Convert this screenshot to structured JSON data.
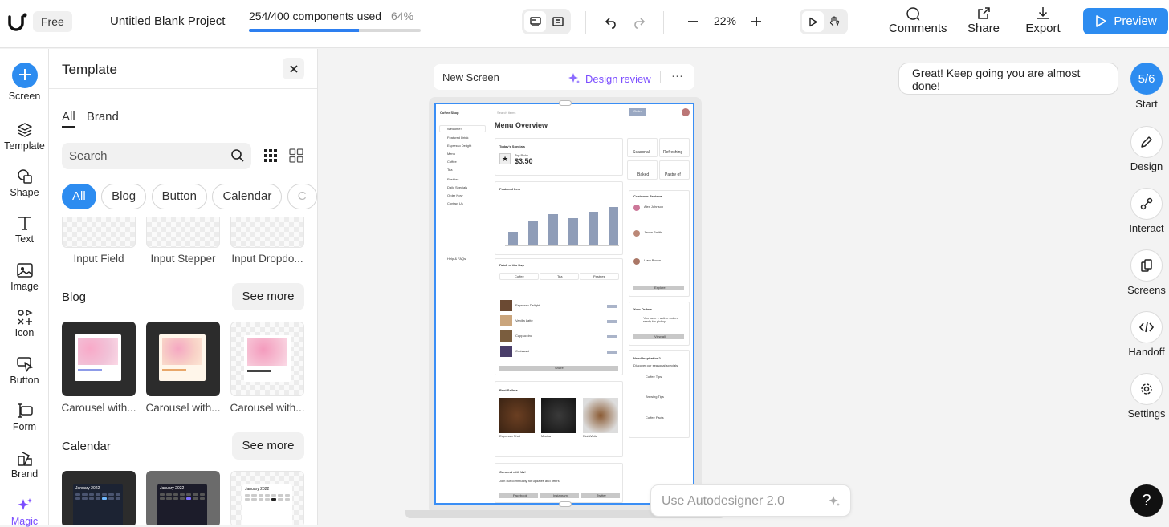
{
  "topbar": {
    "plan_badge": "Free",
    "project_title": "Untitled Blank Project",
    "usage_text": "254/400 components used",
    "usage_percent_text": "64%",
    "usage_fraction": 0.64,
    "zoom_level": "22%",
    "comments_label": "Comments",
    "share_label": "Share",
    "export_label": "Export",
    "preview_label": "Preview",
    "accent_color": "#2d8cf0"
  },
  "left_nav": [
    {
      "label": "Screen",
      "icon": "plus-icon"
    },
    {
      "label": "Template",
      "icon": "layers-icon"
    },
    {
      "label": "Shape",
      "icon": "shape-icon"
    },
    {
      "label": "Text",
      "icon": "text-icon"
    },
    {
      "label": "Image",
      "icon": "image-icon"
    },
    {
      "label": "Icon",
      "icon": "icon-set-icon"
    },
    {
      "label": "Button",
      "icon": "button-icon"
    },
    {
      "label": "Form",
      "icon": "form-icon"
    },
    {
      "label": "Brand",
      "icon": "brand-icon"
    },
    {
      "label": "Magic",
      "icon": "sparkle-icon"
    }
  ],
  "panel": {
    "title": "Template",
    "tabs": [
      "All",
      "Brand"
    ],
    "search_placeholder": "Search",
    "chips": [
      "All",
      "Blog",
      "Button",
      "Calendar",
      "C"
    ],
    "form_items": [
      "Input Field",
      "Input Stepper",
      "Input Dropdo..."
    ],
    "sections": [
      {
        "title": "Blog",
        "see_more": "See more",
        "items": [
          "Carousel with...",
          "Carousel with...",
          "Carousel with..."
        ]
      },
      {
        "title": "Calendar",
        "see_more": "See more",
        "items": [
          "January 2022",
          "January 2022",
          "January 2022"
        ]
      }
    ]
  },
  "canvas": {
    "screen_name": "New Screen",
    "design_review": "Design review",
    "more": "···",
    "mockup": {
      "app": "Coffee Shop",
      "search": "Search items",
      "order_btn": "Order",
      "nav": [
        "Welcome!",
        "Featured Drink",
        "Espresso Delight",
        "Menu",
        "Coffee",
        "Tea",
        "Pastries",
        "Daily Specials",
        "Order Now",
        "Contact Us"
      ],
      "help": "Help & FAQs",
      "heading": "Menu Overview",
      "specials_title": "Today's Specials",
      "top_picks": "Top Picks",
      "price": "$3.50",
      "tiles": [
        "Seasonal",
        "Refreshing",
        "Baked",
        "Pastry of"
      ],
      "featured_title": "Featured Item",
      "chart_bars": [
        0.3,
        0.55,
        0.7,
        0.6,
        0.75,
        0.85
      ],
      "chart_cats": [
        "Latte",
        "Cappucc.",
        "Mocha",
        "Americano",
        "Flat",
        "Affogato"
      ],
      "drink_title": "Drink of the Day",
      "drink_tabs": [
        "Coffee",
        "Tea",
        "Pastries"
      ],
      "drinks": [
        "Espresso Delight",
        "Vanilla Latte",
        "Cappuccino",
        "Croissant"
      ],
      "share_btn": "Share",
      "bestsellers_title": "Best Sellers",
      "bestsellers": [
        "Espresso Shot",
        "Mocha",
        "Iced Coffee",
        "Flat White"
      ],
      "connect_title": "Connect with Us!",
      "connect_text": "Join our community for updates and offers.",
      "social": [
        "Facebook",
        "Instagram",
        "Twitter"
      ],
      "reviews_title": "Customer Reviews",
      "reviewers": [
        "Alex Johnson",
        "Jenna Smith",
        "Liam Brown"
      ],
      "explore": "Explore",
      "orders_title": "Your Orders",
      "orders_text": "You have 1 active orders ready for pickup.",
      "view_all": "View all",
      "inspire_title": "Need Inspiration?",
      "inspire_text": "Discover our seasonal specials!",
      "tips": [
        "Coffee Tips",
        "Brewing Tips",
        "Coffee Facts"
      ]
    },
    "autodesigner_placeholder": "Use Autodesigner 2.0"
  },
  "right_panel": {
    "toast": "Great! Keep going you are almost done!",
    "step": "5/6",
    "step_label": "Start",
    "items": [
      "Design",
      "Interact",
      "Screens",
      "Handoff",
      "Settings"
    ],
    "help": "?"
  }
}
